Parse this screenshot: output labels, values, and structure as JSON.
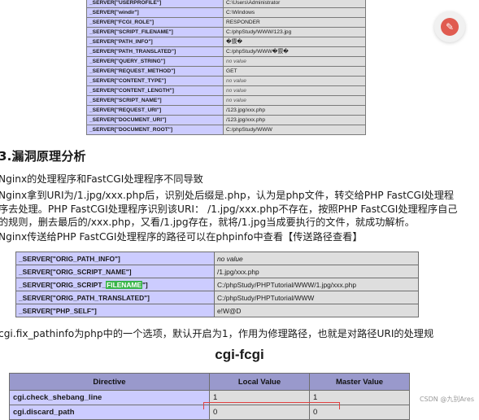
{
  "server_table_1": [
    {
      "key": "_SERVER[\"USERPROFILE\"]",
      "value": "C:\\Users\\Administrator",
      "italic": false
    },
    {
      "key": "_SERVER[\"windir\"]",
      "value": "C:\\Windows",
      "italic": false
    },
    {
      "key": "_SERVER[\"FCGI_ROLE\"]",
      "value": "RESPONDER",
      "italic": false
    },
    {
      "key": "_SERVER[\"SCRIPT_FILENAME\"]",
      "value": "C:/phpStudy/WWW/123.jpg",
      "italic": false
    },
    {
      "key": "_SERVER[\"PATH_INFO\"]",
      "value": "�鍥�",
      "italic": false
    },
    {
      "key": "_SERVER[\"PATH_TRANSLATED\"]",
      "value": "C:/phpStudy/WWW�鍥�",
      "italic": false
    },
    {
      "key": "_SERVER[\"QUERY_STRING\"]",
      "value": "no value",
      "italic": true
    },
    {
      "key": "_SERVER[\"REQUEST_METHOD\"]",
      "value": "GET",
      "italic": false
    },
    {
      "key": "_SERVER[\"CONTENT_TYPE\"]",
      "value": "no value",
      "italic": true
    },
    {
      "key": "_SERVER[\"CONTENT_LENGTH\"]",
      "value": "no value",
      "italic": true
    },
    {
      "key": "_SERVER[\"SCRIPT_NAME\"]",
      "value": "no value",
      "italic": true
    },
    {
      "key": "_SERVER[\"REQUEST_URI\"]",
      "value": "/123.jpg/xxx.php",
      "italic": false
    },
    {
      "key": "_SERVER[\"DOCUMENT_URI\"]",
      "value": "/123.jpg/xxx.php",
      "italic": false
    },
    {
      "key": "_SERVER[\"DOCUMENT_ROOT\"]",
      "value": "C:/phpStudy/WWW",
      "italic": false
    }
  ],
  "section_title": "3.漏洞原理分析",
  "paragraphs": [
    "Nginx的处理程序和FastCGI处理程序不同导致",
    "Nginx拿到URI为/1.jpg/xxx.php后，识别处后缀是.php，认为是php文件，转交给PHP FastCGI处理程",
    "序去处理。PHP FastCGI处理程序识别该URI： /1.jpg/xxx.php不存在，按照PHP FastCGI处理程序自己",
    "的规则，删去最后的/xxx.php，又看/1.jpg存在，就将/1.jpg当成要执行的文件，就成功解析。",
    "Nginx传送给PHP FastCGI处理程序的路径可以在phpinfo中查看【传送路径查看】"
  ],
  "server_table_2": [
    {
      "key": "_SERVER[\"ORIG_PATH_INFO\"]",
      "value": "no value",
      "italic": true
    },
    {
      "key_pre": "_SERVER[\"ORIG_SCRIPT_NAME\"]",
      "value": "/1.jpg/xxx.php",
      "italic": false
    },
    {
      "key_pre": "_SERVER[\"ORIG_SCRIPT_",
      "key_hl": "FILENAME",
      "key_post": "\"]",
      "value": "C:/phpStudy/PHPTutorial/WWW/1.jpg/xxx.php",
      "italic": false
    },
    {
      "key": "_SERVER[\"ORIG_PATH_TRANSLATED\"]",
      "value": "C:/phpStudy/PHPTutorial/WWW",
      "italic": false
    },
    {
      "key": "_SERVER[\"PHP_SELF\"]",
      "value": "e!W@D",
      "italic": false
    }
  ],
  "cgi_note": "cgi.fix_pathinfo为php中的一个选项，默认开启为1，作用为修理路径，也就是对路径URI的处理规",
  "cgi_title": "cgi-fcgi",
  "cgi_table": {
    "headers": [
      "Directive",
      "Local Value",
      "Master Value"
    ],
    "rows": [
      {
        "directive": "cgi.check_shebang_line",
        "local": "1",
        "master": "1"
      },
      {
        "directive": "cgi.discard_path",
        "local": "0",
        "master": "0"
      }
    ]
  },
  "watermark": "CSDN @九别Ares",
  "colors": {
    "key_bg": "#ccccff",
    "value_bg": "#dedede",
    "header_bg": "#9999cc",
    "highlight": "#39b54a",
    "redbox": "#e04040"
  }
}
